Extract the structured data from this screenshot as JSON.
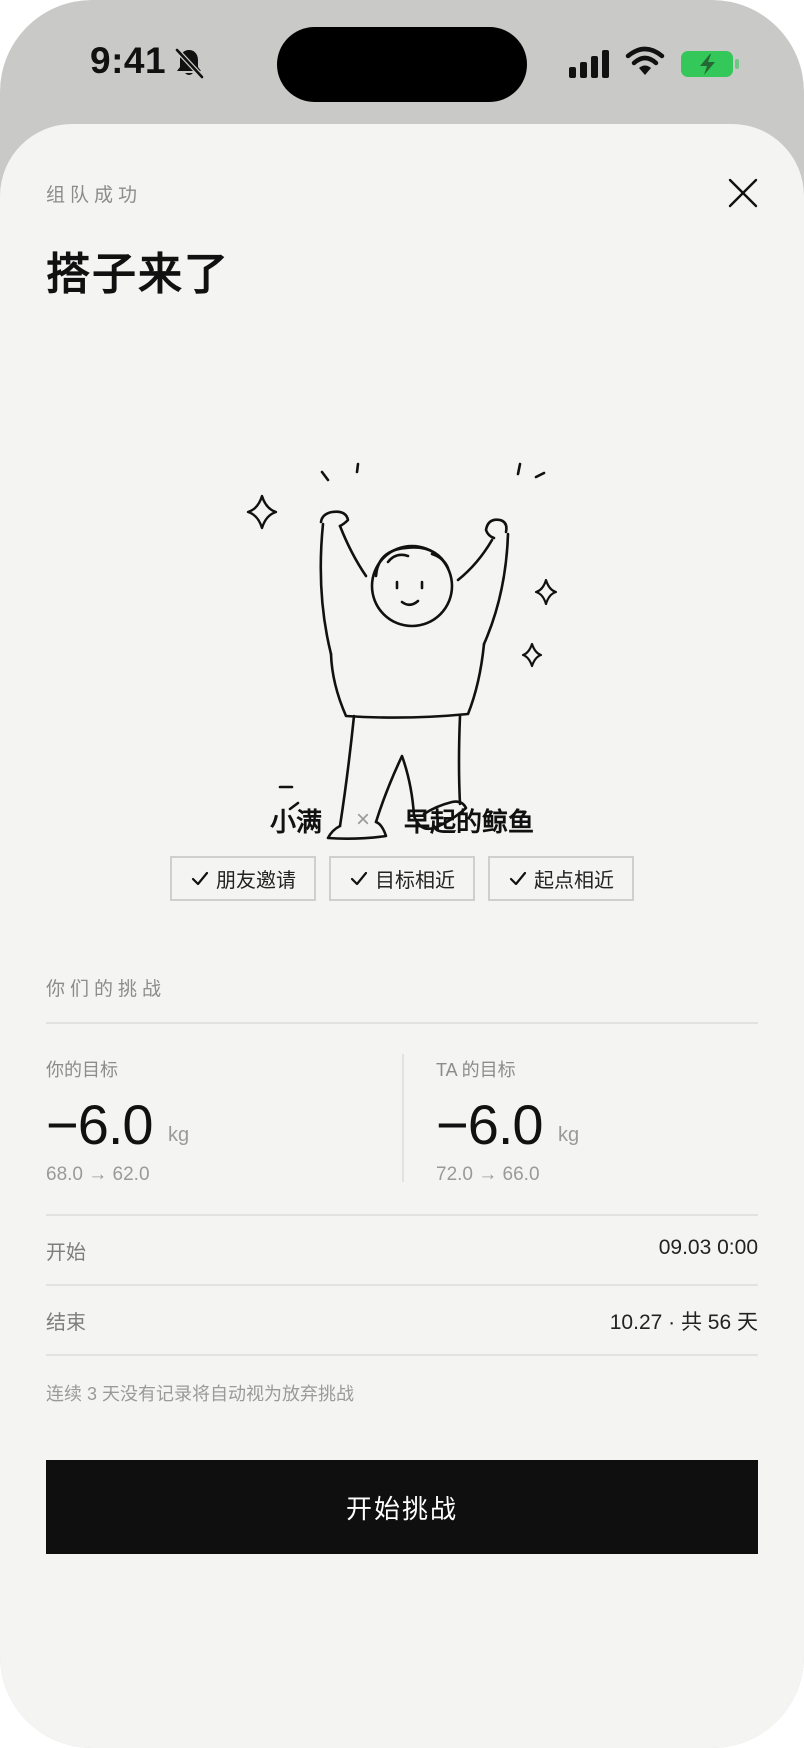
{
  "status_bar": {
    "time": "9:41",
    "icons": [
      "bell-slash-icon",
      "cellular-signal-icon",
      "wifi-icon",
      "battery-charging-icon"
    ],
    "battery_color": "#34c759"
  },
  "sheet": {
    "kicker": "组队成功",
    "title": "搭子来了",
    "close_icon": "close-icon",
    "illustration": "cheering-person-illustration"
  },
  "pair": {
    "user_a": "小满",
    "separator": "×",
    "user_b": "早起的鲸鱼"
  },
  "tags": [
    {
      "label": "朋友邀请",
      "icon": "check-icon"
    },
    {
      "label": "目标相近",
      "icon": "check-icon"
    },
    {
      "label": "起点相近",
      "icon": "check-icon"
    }
  ],
  "challenge": {
    "section_label": "你们的挑战",
    "mine": {
      "label": "你的目标",
      "value": "−6.0",
      "unit": "kg",
      "range": "68.0 → 62.0"
    },
    "theirs": {
      "label": "TA 的目标",
      "value": "−6.0",
      "unit": "kg",
      "range": "72.0 → 66.0"
    },
    "start": {
      "label": "开始",
      "value": "09.03 0:00"
    },
    "end": {
      "label": "结束",
      "value": "10.27 · 共 56 天"
    },
    "note": "连续 3 天没有记录将自动视为放弃挑战"
  },
  "cta": {
    "label": "开始挑战",
    "background": "#0f0f0f"
  }
}
